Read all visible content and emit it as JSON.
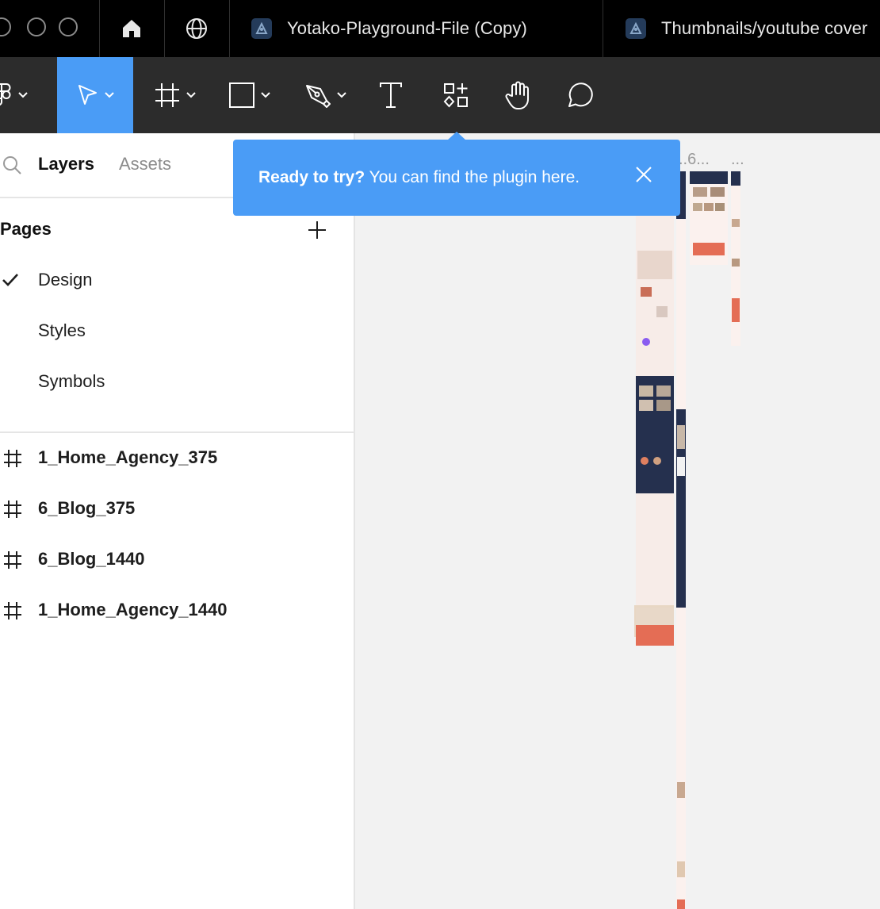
{
  "tabs": [
    {
      "label": "Yotako-Playground-File (Copy)",
      "icon": "figma-file-icon"
    },
    {
      "label": "Thumbnails/youtube cover",
      "icon": "figma-file-icon"
    }
  ],
  "toolbar": {
    "tools": [
      "main-menu",
      "move",
      "frame",
      "shape",
      "pen",
      "text",
      "resources",
      "hand",
      "comment"
    ],
    "active_tool": "move",
    "accent": "#4a9cf6"
  },
  "panel": {
    "tab_layers": "Layers",
    "tab_assets": "Assets",
    "pages_heading": "Pages",
    "pages": [
      {
        "label": "Design",
        "selected": true
      },
      {
        "label": "Styles",
        "selected": false
      },
      {
        "label": "Symbols",
        "selected": false
      }
    ],
    "frames": [
      {
        "label": "1_Home_Agency_375"
      },
      {
        "label": "6_Blog_375"
      },
      {
        "label": "6_Blog_1440"
      },
      {
        "label": "1_Home_Agency_1440"
      }
    ]
  },
  "canvas": {
    "frame_labels": [
      "..6...",
      "..."
    ]
  },
  "tooltip": {
    "bold": "Ready to try?",
    "text": " You can find the plugin here."
  }
}
